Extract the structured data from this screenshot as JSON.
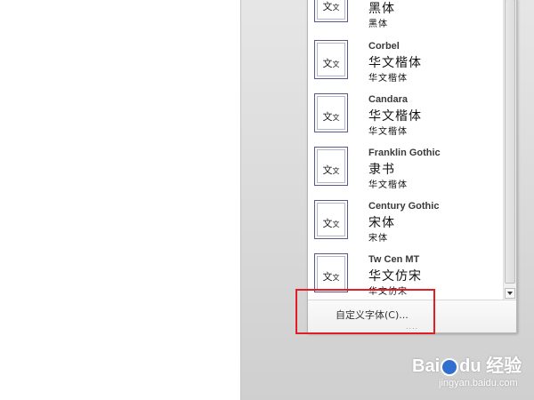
{
  "dropdown": {
    "items": [
      {
        "name": "",
        "heading": "黑体",
        "body": "黑体",
        "thumb": [
          "文",
          "文"
        ]
      },
      {
        "name": "Corbel",
        "heading": "华文楷体",
        "body": "华文楷体",
        "thumb": [
          "文",
          "文"
        ]
      },
      {
        "name": "Candara",
        "heading": "华文楷体",
        "body": "华文楷体",
        "thumb": [
          "文",
          "文"
        ]
      },
      {
        "name": "Franklin Gothic",
        "heading": "隶书",
        "body": "华文楷体",
        "thumb": [
          "文",
          "文"
        ]
      },
      {
        "name": "Century Gothic",
        "heading": "宋体",
        "body": "宋体",
        "thumb": [
          "文",
          "文"
        ]
      },
      {
        "name": "Tw Cen MT",
        "heading": "华文仿宋",
        "body": "华文仿宋",
        "thumb": [
          "文",
          "文"
        ]
      }
    ],
    "custom_fonts_label": "自定义字体(C)...",
    "resize_grip": "....",
    "scrollbar_down_icon": "triangle-down-icon"
  },
  "annotation": {
    "color": "#e01f25"
  },
  "watermark": {
    "brand_prefix": "Bai",
    "brand_suffix": "经验",
    "url": "jingyan.baidu.com"
  }
}
